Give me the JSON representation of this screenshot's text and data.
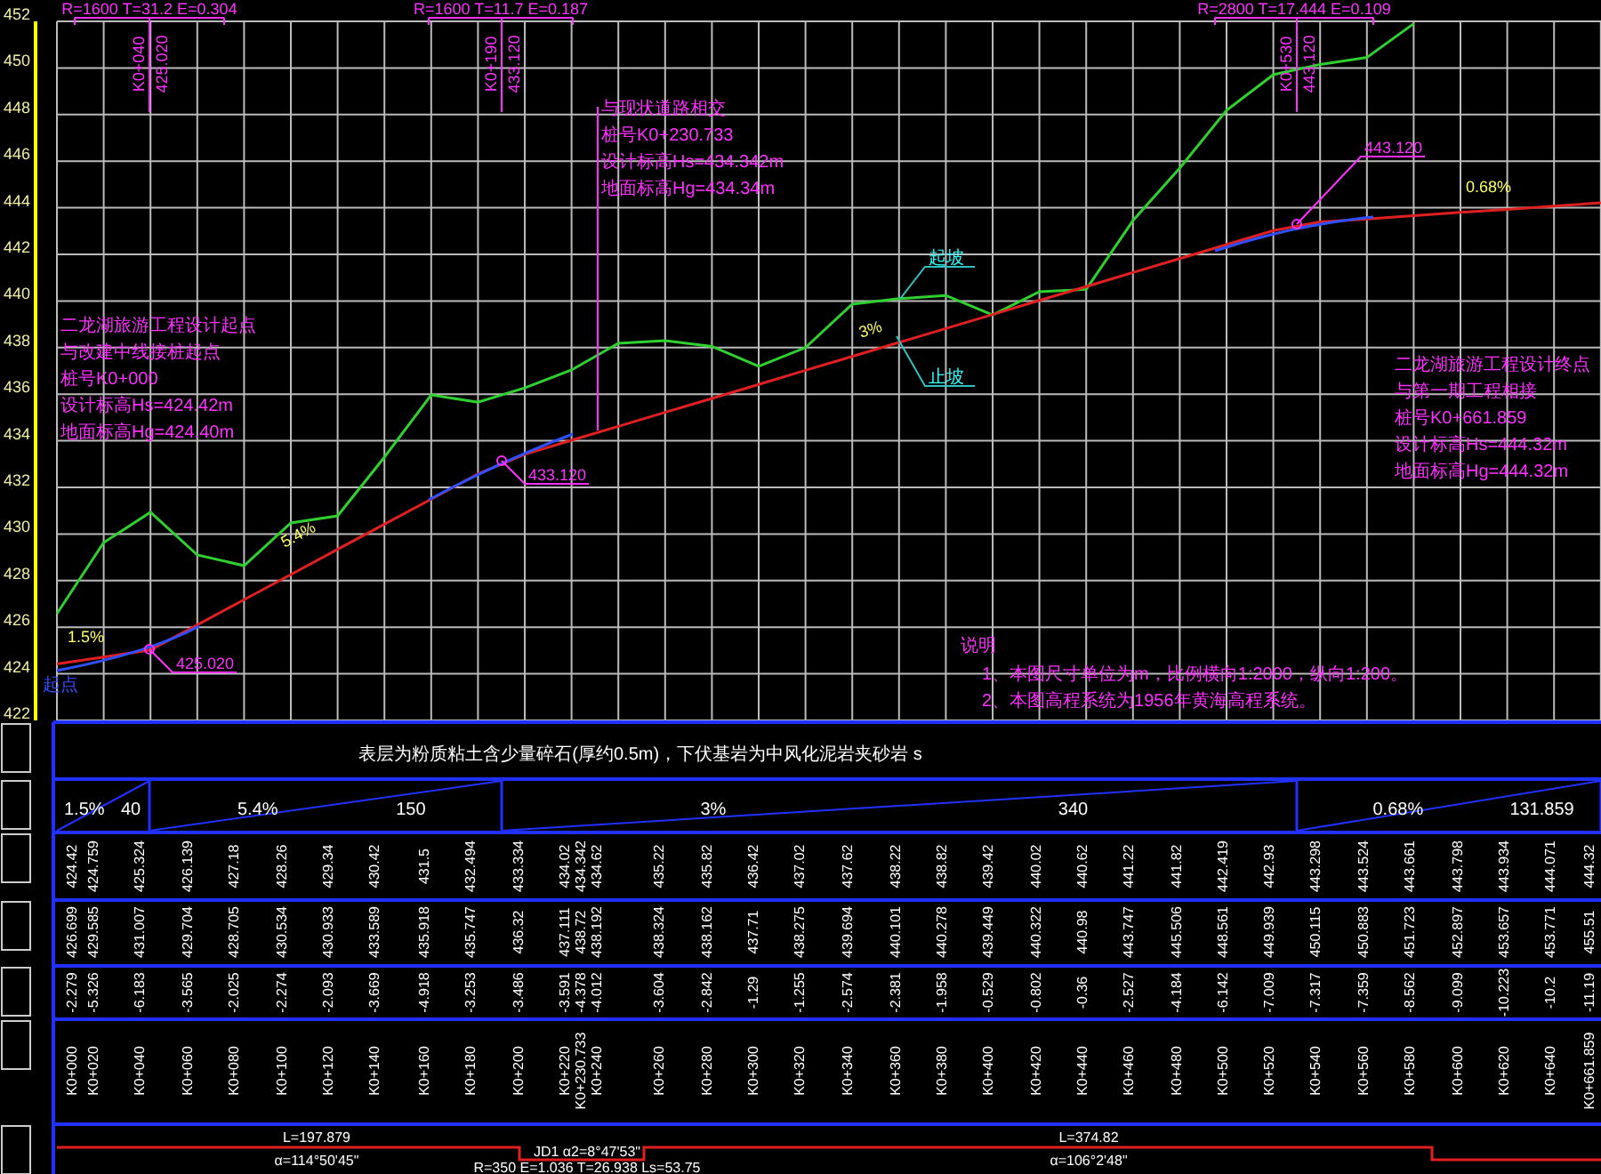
{
  "profile": {
    "chart_data": {
      "type": "line",
      "categories": [
        null,
        null,
        null,
        null,
        null,
        null,
        null,
        null,
        null,
        null,
        null,
        null,
        null,
        null,
        null,
        null,
        null,
        null,
        null,
        null,
        null,
        null,
        null,
        null,
        null,
        null,
        null,
        null,
        null,
        null,
        null,
        null,
        null,
        null
      ],
      "series": [
        {
          "color": "#30d030",
          "values": [
            426.58,
            429.63,
            430.93,
            429.1,
            428.64,
            430.47,
            430.78,
            433.3,
            435.97,
            435.66,
            436.27,
            437.04,
            438.18,
            438.3,
            438.05,
            437.2,
            438.0,
            439.86,
            440.1,
            440.24,
            439.4,
            440.4,
            440.5,
            443.45,
            445.7,
            448.18,
            449.71,
            450.15,
            450.45,
            451.9,
            null,
            null,
            null,
            null
          ]
        },
        {
          "color": "#e02020",
          "values": [
            424.42,
            424.72,
            425.02,
            426.1,
            427.18,
            428.26,
            429.34,
            430.42,
            431.5,
            432.58,
            433.42,
            434.02,
            434.62,
            435.22,
            435.82,
            436.42,
            437.02,
            437.62,
            438.22,
            438.82,
            439.42,
            440.02,
            440.62,
            441.22,
            441.82,
            442.42,
            443.02,
            443.39,
            443.52,
            443.66,
            443.8,
            443.93,
            444.07,
            444.21
          ]
        }
      ],
      "ylim": [
        422,
        452
      ],
      "yticks": [
        452,
        450,
        448,
        446,
        444,
        442,
        440,
        438,
        436,
        434,
        432,
        430,
        428,
        426,
        424,
        422
      ]
    }
  },
  "vertical_curves": [
    {
      "label": "R=1600 T=31.2 E=0.304",
      "station": "K0+040",
      "elevation": "425.020",
      "point_label": "425.020"
    },
    {
      "label": "R=1600 T=11.7 E=0.187",
      "station": "K0+190",
      "elevation": "433.120",
      "point_label": "433.120"
    },
    {
      "label": "R=2800 T=17.444 E=0.109",
      "station": "K0+530",
      "elevation": "443.120",
      "point_label": "443.120"
    }
  ],
  "grade_labels": [
    "1.5%",
    "5.4%",
    "3%",
    "0.68%"
  ],
  "slope_marks": [
    "起坡",
    "止坡"
  ],
  "start_mark": "起点",
  "annotations": [
    {
      "lines": [
        "二龙湖旅游工程设计起点",
        "与改建中线接桩起点",
        "桩号K0+000",
        "设计标高Hs=424.42m",
        "地面标高Hg=424.40m"
      ]
    },
    {
      "lines": [
        "与现状道路相交",
        "桩号K0+230.733",
        "设计标高Hs=434.342m",
        "地面标高Hg=434.34m"
      ]
    },
    {
      "lines": [
        "二龙湖旅游工程设计终点",
        "与第一期工程相接",
        "桩号K0+661.859",
        "设计标高Hs=444.32m",
        "地面标高Hg=444.32m"
      ]
    }
  ],
  "notes": {
    "title": "说明",
    "items": [
      "1、本图尺寸单位为m，比例横向1:2000，纵向1:200。",
      "2、本图高程系统为1956年黄海高程系统。"
    ]
  },
  "table": {
    "title": "表层为粉质粘土含少量碎石(厚约0.5m)，下伏基岩为中风化泥岩夹砂岩 s",
    "grade_segments": [
      {
        "grade": "1.5%",
        "length": "40"
      },
      {
        "grade": "5.4%",
        "length": "150"
      },
      {
        "grade": "3%",
        "length": "340"
      },
      {
        "grade": "0.68%",
        "length": "131.859"
      }
    ],
    "stations": [
      {
        "station": "K0+000",
        "design": "424.42",
        "ground": "426.699",
        "cut": "-2.279"
      },
      {
        "station": "K0+020",
        "design": "424.759",
        "ground": "429.585",
        "cut": "-5.326"
      },
      {
        "station": "K0+040",
        "design": "425.324",
        "ground": "431.007",
        "cut": "-6.183"
      },
      {
        "station": "K0+060",
        "design": "426.139",
        "ground": "429.704",
        "cut": "-3.565"
      },
      {
        "station": "K0+080",
        "design": "427.18",
        "ground": "428.705",
        "cut": "-2.025"
      },
      {
        "station": "K0+100",
        "design": "428.26",
        "ground": "430.534",
        "cut": "-2.274"
      },
      {
        "station": "K0+120",
        "design": "429.34",
        "ground": "430.933",
        "cut": "-2.093"
      },
      {
        "station": "K0+140",
        "design": "430.42",
        "ground": "433.589",
        "cut": "-3.669"
      },
      {
        "station": "K0+160",
        "design": "431.5",
        "ground": "435.918",
        "cut": "-4.918"
      },
      {
        "station": "K0+180",
        "design": "432.494",
        "ground": "435.747",
        "cut": "-3.253"
      },
      {
        "station": "K0+200",
        "design": "433.334",
        "ground": "436.32",
        "cut": "-3.486"
      },
      {
        "station": "K0+220",
        "design": "434.02",
        "ground": "437.111",
        "cut": "-3.591"
      },
      {
        "station": "K0+230.733",
        "design": "434.342",
        "ground": "438.72",
        "cut": "-4.378"
      },
      {
        "station": "K0+240",
        "design": "434.62",
        "ground": "438.192",
        "cut": "-4.012"
      },
      {
        "station": "K0+260",
        "design": "435.22",
        "ground": "438.324",
        "cut": "-3.604"
      },
      {
        "station": "K0+280",
        "design": "435.82",
        "ground": "438.162",
        "cut": "-2.842"
      },
      {
        "station": "K0+300",
        "design": "436.42",
        "ground": "437.71",
        "cut": "-1.29"
      },
      {
        "station": "K0+320",
        "design": "437.02",
        "ground": "438.275",
        "cut": "-1.255"
      },
      {
        "station": "K0+340",
        "design": "437.62",
        "ground": "439.694",
        "cut": "-2.574"
      },
      {
        "station": "K0+360",
        "design": "438.22",
        "ground": "440.101",
        "cut": "-2.381"
      },
      {
        "station": "K0+380",
        "design": "438.82",
        "ground": "440.278",
        "cut": "-1.958"
      },
      {
        "station": "K0+400",
        "design": "439.42",
        "ground": "439.449",
        "cut": "-0.529"
      },
      {
        "station": "K0+420",
        "design": "440.02",
        "ground": "440.322",
        "cut": "-0.802"
      },
      {
        "station": "K0+440",
        "design": "440.62",
        "ground": "440.98",
        "cut": "-0.36"
      },
      {
        "station": "K0+460",
        "design": "441.22",
        "ground": "443.747",
        "cut": "-2.527"
      },
      {
        "station": "K0+480",
        "design": "441.82",
        "ground": "445.506",
        "cut": "-4.184"
      },
      {
        "station": "K0+500",
        "design": "442.419",
        "ground": "448.561",
        "cut": "-6.142"
      },
      {
        "station": "K0+520",
        "design": "442.93",
        "ground": "449.939",
        "cut": "-7.009"
      },
      {
        "station": "K0+540",
        "design": "443.298",
        "ground": "450.115",
        "cut": "-7.317"
      },
      {
        "station": "K0+560",
        "design": "443.524",
        "ground": "450.883",
        "cut": "-7.359"
      },
      {
        "station": "K0+580",
        "design": "443.661",
        "ground": "451.723",
        "cut": "-8.562"
      },
      {
        "station": "K0+600",
        "design": "443.798",
        "ground": "452.897",
        "cut": "-9.099"
      },
      {
        "station": "K0+620",
        "design": "443.934",
        "ground": "453.657",
        "cut": "-10.223"
      },
      {
        "station": "K0+640",
        "design": "444.071",
        "ground": "453.771",
        "cut": "-10.2"
      },
      {
        "station": "K0+661.859",
        "design": "444.32",
        "ground": "455.51",
        "cut": "-11.19"
      }
    ],
    "alignment": [
      {
        "length": "L=197.879",
        "angle": "α=114°50'45\""
      },
      {
        "label": "JD1 α2=8°47'53\"",
        "params": "R=350 E=1.036 T=26.938 Ls=53.75"
      },
      {
        "length": "L=374.82",
        "angle": "α=106°2'48\""
      }
    ]
  }
}
